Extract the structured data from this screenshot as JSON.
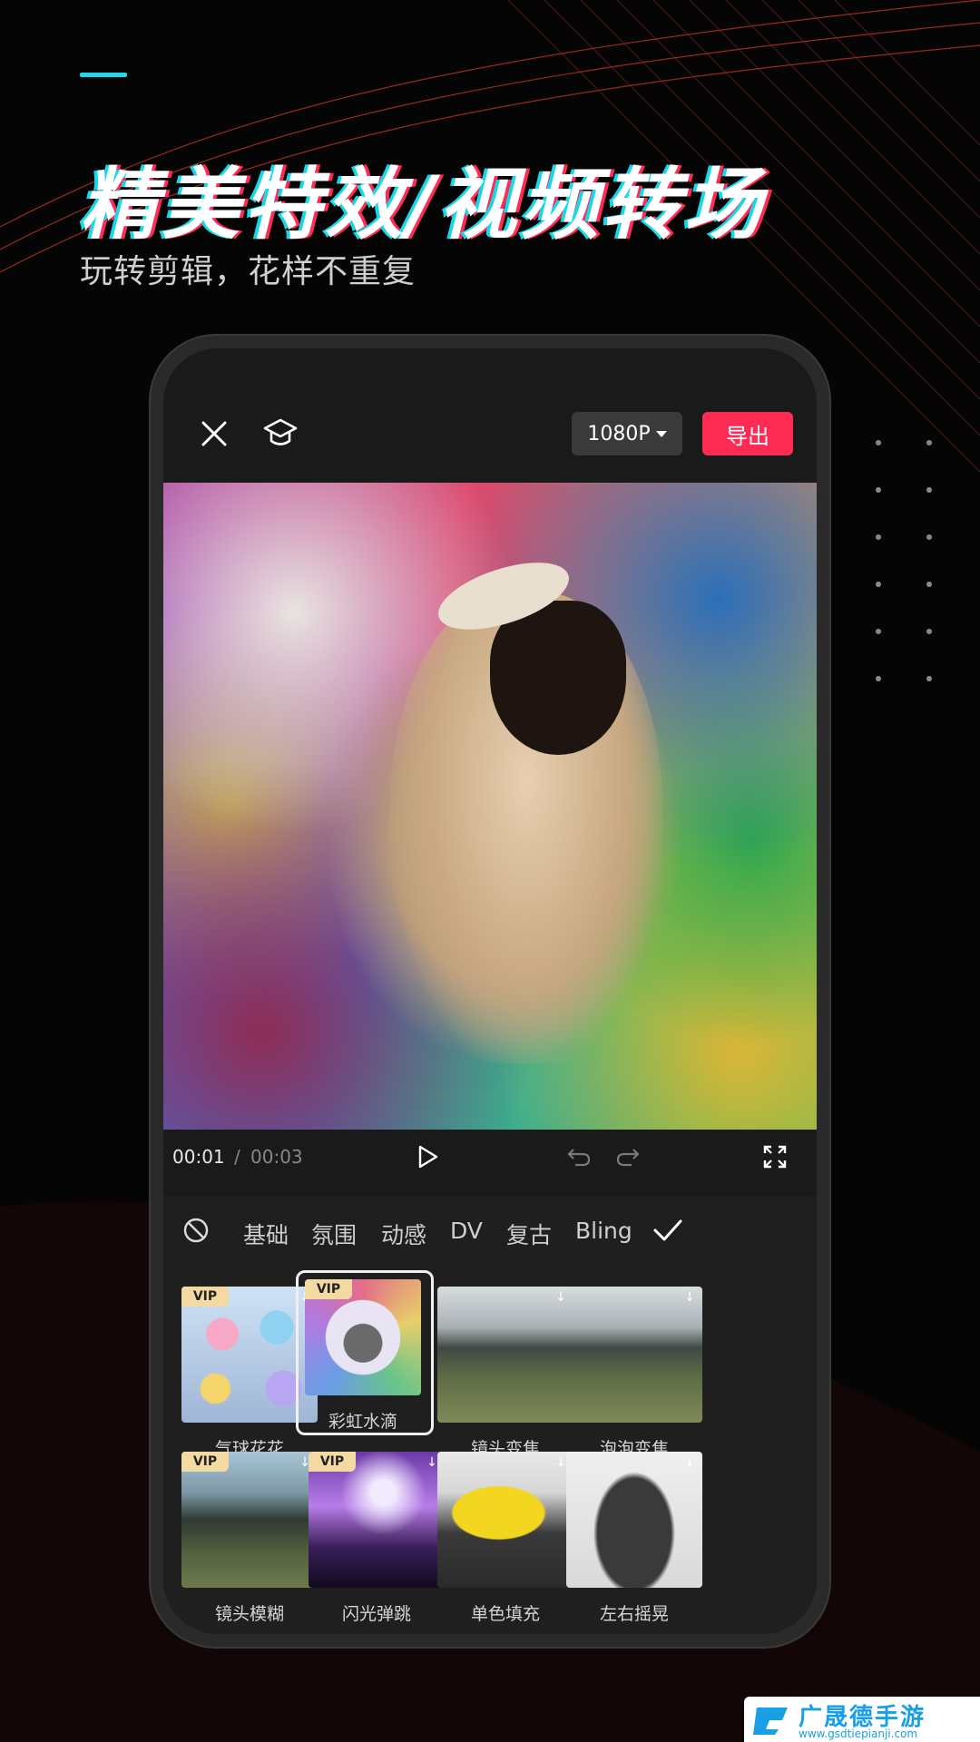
{
  "promo": {
    "headline": "精美特效/视频转场",
    "subheadline": "玩转剪辑，花样不重复"
  },
  "editor": {
    "toolbar": {
      "resolution_label": "1080P",
      "export_label": "导出"
    },
    "playback": {
      "current_time": "00:01",
      "separator": "/",
      "total_time": "00:03"
    },
    "effects_panel": {
      "tabs": [
        "基础",
        "氛围",
        "动感",
        "DV",
        "复古",
        "Bling"
      ],
      "vip_badge": "VIP",
      "items": [
        {
          "label": "气球花花",
          "vip": true,
          "selected": false
        },
        {
          "label": "彩虹水滴",
          "vip": true,
          "selected": true
        },
        {
          "label": "镜头变焦",
          "vip": false,
          "selected": false
        },
        {
          "label": "泡泡变焦",
          "vip": false,
          "selected": false
        },
        {
          "label": "镜头模糊",
          "vip": true,
          "selected": false
        },
        {
          "label": "闪光弹跳",
          "vip": true,
          "selected": false
        },
        {
          "label": "单色填充",
          "vip": false,
          "selected": false
        },
        {
          "label": "左右摇晃",
          "vip": false,
          "selected": false
        }
      ]
    }
  },
  "watermark": {
    "brand": "广晟德手游",
    "url": "www.gsdtiepianji.com"
  },
  "colors": {
    "accent_red": "#fe2c55",
    "accent_cyan": "#25d8e8",
    "background": "#050505"
  }
}
